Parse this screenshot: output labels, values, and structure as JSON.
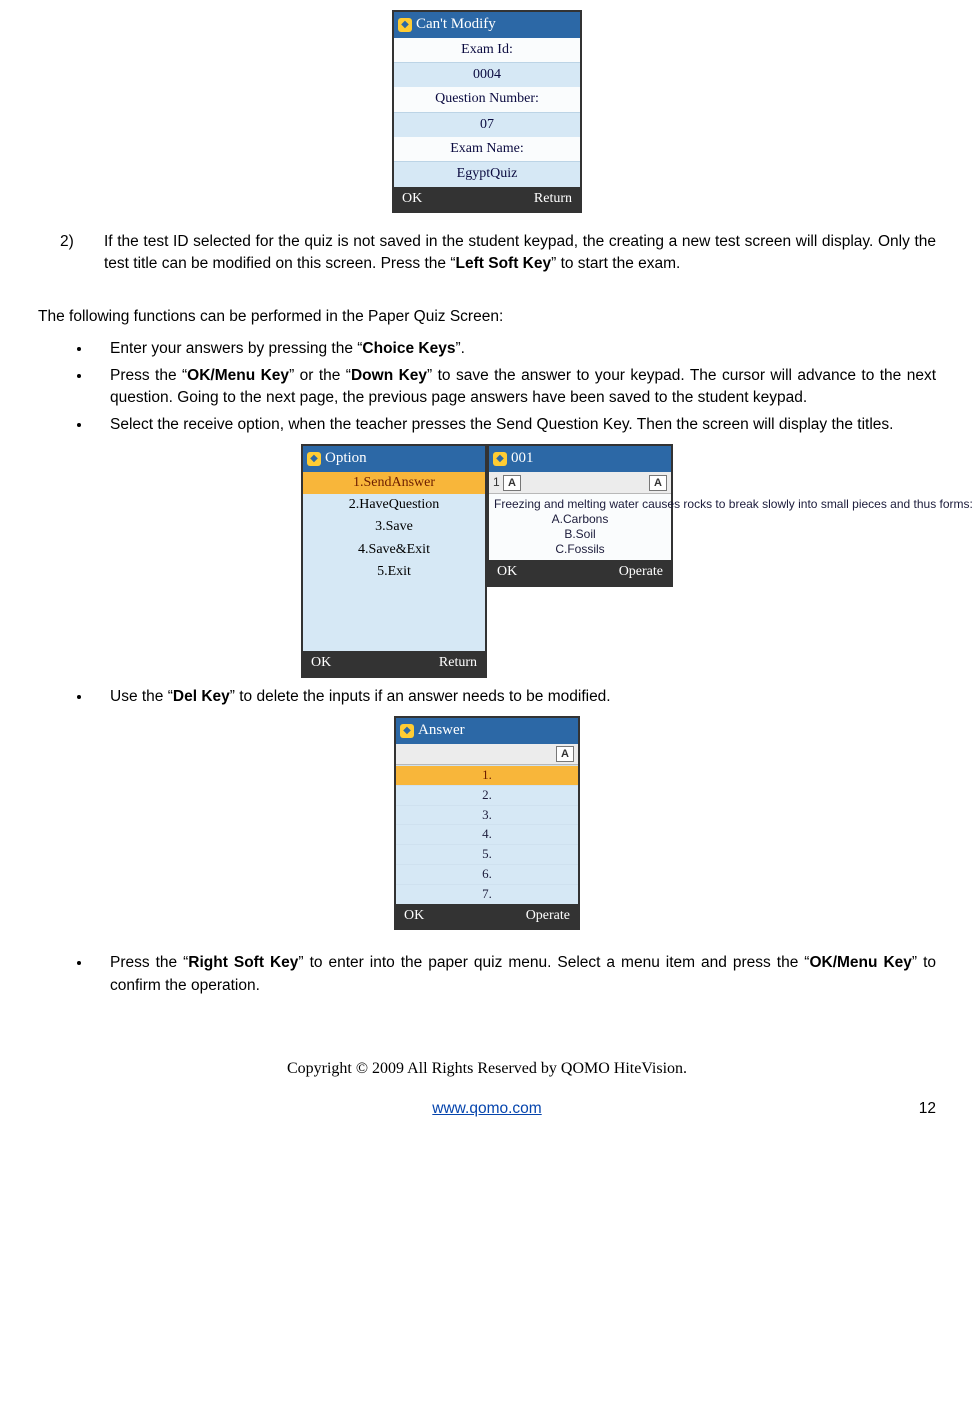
{
  "phone1": {
    "title": "Can't  Modify",
    "examid_lbl": "Exam Id:",
    "examid_val": "0004",
    "qnum_lbl": "Question Number:",
    "qnum_val": "07",
    "examname_lbl": "Exam Name:",
    "examname_val": "EgyptQuiz",
    "soft_left": "OK",
    "soft_right": "Return"
  },
  "step2": {
    "num": "2)",
    "text_a": "If the test ID selected for the quiz is not saved in the student keypad, the creating a new test screen will display. Only the test title can be modified on this screen.  Press the “",
    "bold_a": "Left Soft Key",
    "text_b": "” to start the exam."
  },
  "intro": "The following functions can be performed in the Paper Quiz Screen:",
  "bul1": {
    "a": "Enter your answers by pressing the “",
    "b": "Choice Keys",
    "c": "”."
  },
  "bul2": {
    "a": "Press the “",
    "b": "OK/Menu Key",
    "c": "” or the “",
    "d": "Down Key",
    "e": "” to save the answer to your keypad. The cursor will advance to the next question. Going to the next page, the previous page answers have been saved to the student keypad."
  },
  "bul3": "Select the receive option, when the teacher presses the Send Question Key. Then the screen will display the titles.",
  "phone2a": {
    "title": "Option",
    "items": [
      "1.SendAnswer",
      "2.HaveQuestion",
      "3.Save",
      "4.Save&Exit",
      "5.Exit"
    ],
    "soft_left": "OK",
    "soft_right": "Return"
  },
  "phone2b": {
    "title": "001",
    "head_num": "1",
    "head_mode": "A",
    "head_ans": "A",
    "body": "Freezing and melting water causes rocks to break slowly into small pieces and thus forms:",
    "opts": [
      "A.Carbons",
      "B.Soil",
      "C.Fossils"
    ],
    "soft_left": "OK",
    "soft_right": "Operate"
  },
  "bul4": {
    "a": "Use the “",
    "b": "Del Key",
    "c": "” to delete the inputs if an answer needs to be modified."
  },
  "phone3": {
    "title": "Answer",
    "head_ans": "A",
    "rows": [
      "1.",
      "2.",
      "3.",
      "4.",
      "5.",
      "6.",
      "7."
    ],
    "soft_left": "OK",
    "soft_right": "Operate"
  },
  "bul5": {
    "a": "Press the “",
    "b": "Right Soft Key",
    "c": "” to enter into the paper quiz menu. Select a menu item and press the “",
    "d": "OK/Menu Key",
    "e": "” to confirm the operation."
  },
  "footer": {
    "copyright": "Copyright © 2009 All Rights Reserved by QOMO HiteVision.",
    "link": "www.qomo.com",
    "page": "12"
  }
}
